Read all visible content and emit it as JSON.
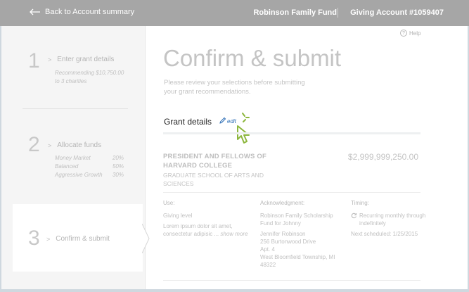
{
  "header": {
    "back_label": "Back to Account summary",
    "fund_name": "Robinson Family Fund",
    "account": "Giving Account #1059407"
  },
  "sidebar": {
    "steps": [
      {
        "number": "1",
        "title": "Enter grant details",
        "sub": [
          "Recommending $10,750.00",
          "to 3 charities"
        ]
      },
      {
        "number": "2",
        "title": "Allocate funds",
        "allocations": [
          {
            "name": "Money Market",
            "pct": "20%"
          },
          {
            "name": "Balanced",
            "pct": "50%"
          },
          {
            "name": "Aggressive Growth",
            "pct": "30%"
          }
        ]
      },
      {
        "number": "3",
        "title": "Confirm & submit"
      }
    ]
  },
  "main": {
    "help_label": "Help",
    "title": "Confirm & submit",
    "subtitle": "Please review your selections before submitting your grant recommendations.",
    "grant_heading": "Grant details",
    "edit_label": "edit",
    "org_name": "PRESIDENT AND FELLOWS OF HARVARD COLLEGE",
    "org_sub": "GRADUATE SCHOOL OF ARTS AND SCIENCES",
    "amount": "$2,999,999,250.00",
    "use": {
      "label": "Use:",
      "level": "Giving level",
      "text": "Lorem ipsum dolor sit amet, consectetur adipisic ...",
      "more": "show more"
    },
    "acknowledgment": {
      "label": "Acknowledgment:",
      "lines": [
        "Robinson Family Scholarship",
        "Fund for Johnny",
        "Jennifer Robinson",
        "256 Burtonwood Drive",
        "Apt. 4",
        "West Bloomfield Township, MI",
        "48322"
      ]
    },
    "timing": {
      "label": "Timing:",
      "recurring": "Recurring monthly through indefinitely",
      "next": "Next scheduled: 1/25/2015"
    }
  },
  "colors": {
    "topbar": "#a6a6a6",
    "accent_link": "#2a6cb5",
    "cursor_green": "#8cb63c"
  }
}
